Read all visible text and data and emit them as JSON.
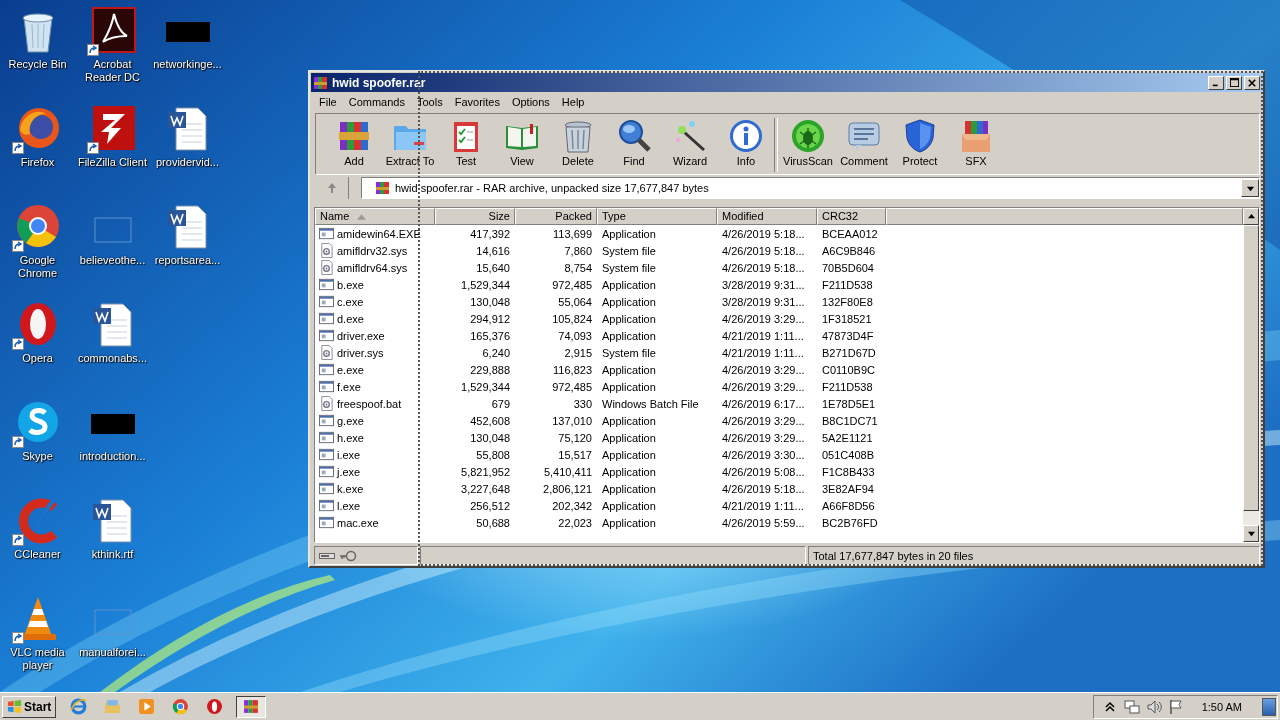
{
  "desktop_icons": [
    {
      "label": "Recycle Bin",
      "kind": "recycle",
      "shortcut": false
    },
    {
      "label": "Firefox",
      "kind": "firefox",
      "shortcut": true
    },
    {
      "label": "Google Chrome",
      "kind": "chrome",
      "shortcut": true
    },
    {
      "label": "Opera",
      "kind": "opera",
      "shortcut": true
    },
    {
      "label": "Skype",
      "kind": "skype",
      "shortcut": true
    },
    {
      "label": "CCleaner",
      "kind": "ccleaner",
      "shortcut": true
    },
    {
      "label": "VLC media player",
      "kind": "vlc",
      "shortcut": true
    },
    {
      "label": "Acrobat Reader DC",
      "kind": "acrobat",
      "shortcut": true
    },
    {
      "label": "FileZilla Client",
      "kind": "filezilla",
      "shortcut": true
    },
    {
      "label": "believeothe...",
      "kind": "blank",
      "shortcut": false
    },
    {
      "label": "commonabs...",
      "kind": "word",
      "shortcut": false
    },
    {
      "label": "introduction...",
      "kind": "redacted",
      "shortcut": false
    },
    {
      "label": "kthink.rtf",
      "kind": "word",
      "shortcut": false
    },
    {
      "label": "manualforei...",
      "kind": "blank",
      "shortcut": false
    },
    {
      "label": "networkinge...",
      "kind": "redacted",
      "shortcut": false
    },
    {
      "label": "providervid...",
      "kind": "word",
      "shortcut": false
    },
    {
      "label": "reportsarea...",
      "kind": "word",
      "shortcut": false
    }
  ],
  "window": {
    "title": "hwid spoofer.rar",
    "menu": [
      "File",
      "Commands",
      "Tools",
      "Favorites",
      "Options",
      "Help"
    ],
    "toolbar": [
      {
        "label": "Add",
        "kind": "add"
      },
      {
        "label": "Extract To",
        "kind": "extract"
      },
      {
        "label": "Test",
        "kind": "test"
      },
      {
        "label": "View",
        "kind": "view"
      },
      {
        "label": "Delete",
        "kind": "delete"
      },
      {
        "label": "Find",
        "kind": "find"
      },
      {
        "label": "Wizard",
        "kind": "wizard"
      },
      {
        "label": "Info",
        "kind": "info"
      },
      {
        "label": "VirusScan",
        "kind": "virusscan"
      },
      {
        "label": "Comment",
        "kind": "comment"
      },
      {
        "label": "Protect",
        "kind": "protect"
      },
      {
        "label": "SFX",
        "kind": "sfx"
      }
    ],
    "address": "hwid spoofer.rar - RAR archive, unpacked size 17,677,847 bytes",
    "columns": [
      {
        "label": "Name",
        "sorted": true
      },
      {
        "label": "Size",
        "sorted": false
      },
      {
        "label": "Packed",
        "sorted": false
      },
      {
        "label": "Type",
        "sorted": false
      },
      {
        "label": "Modified",
        "sorted": false
      },
      {
        "label": "CRC32",
        "sorted": false
      }
    ],
    "rows": [
      {
        "kind": "exe",
        "name": "amidewin64.EXE",
        "size": "417,392",
        "packed": "113,699",
        "type": "Application",
        "modified": "4/26/2019 5:18...",
        "crc": "BCEAA012"
      },
      {
        "kind": "sys",
        "name": "amifldrv32.sys",
        "size": "14,616",
        "packed": "7,860",
        "type": "System file",
        "modified": "4/26/2019 5:18...",
        "crc": "A6C9B846"
      },
      {
        "kind": "sys",
        "name": "amifldrv64.sys",
        "size": "15,640",
        "packed": "8,754",
        "type": "System file",
        "modified": "4/26/2019 5:18...",
        "crc": "70B5D604"
      },
      {
        "kind": "exe",
        "name": "b.exe",
        "size": "1,529,344",
        "packed": "972,485",
        "type": "Application",
        "modified": "3/28/2019 9:31...",
        "crc": "F211D538"
      },
      {
        "kind": "exe",
        "name": "c.exe",
        "size": "130,048",
        "packed": "55,064",
        "type": "Application",
        "modified": "3/28/2019 9:31...",
        "crc": "132F80E8"
      },
      {
        "kind": "exe",
        "name": "d.exe",
        "size": "294,912",
        "packed": "105,824",
        "type": "Application",
        "modified": "4/26/2019 3:29...",
        "crc": "1F318521"
      },
      {
        "kind": "exe",
        "name": "driver.exe",
        "size": "165,376",
        "packed": "74,093",
        "type": "Application",
        "modified": "4/21/2019 1:11...",
        "crc": "47873D4F"
      },
      {
        "kind": "sys",
        "name": "driver.sys",
        "size": "6,240",
        "packed": "2,915",
        "type": "System file",
        "modified": "4/21/2019 1:11...",
        "crc": "B271D67D"
      },
      {
        "kind": "exe",
        "name": "e.exe",
        "size": "229,888",
        "packed": "116,823",
        "type": "Application",
        "modified": "4/26/2019 3:29...",
        "crc": "C0110B9C"
      },
      {
        "kind": "exe",
        "name": "f.exe",
        "size": "1,529,344",
        "packed": "972,485",
        "type": "Application",
        "modified": "4/26/2019 3:29...",
        "crc": "F211D538"
      },
      {
        "kind": "bat",
        "name": "freespoof.bat",
        "size": "679",
        "packed": "330",
        "type": "Windows Batch File",
        "modified": "4/26/2019 6:17...",
        "crc": "1E78D5E1"
      },
      {
        "kind": "exe",
        "name": "g.exe",
        "size": "452,608",
        "packed": "137,010",
        "type": "Application",
        "modified": "4/26/2019 3:29...",
        "crc": "B8C1DC71"
      },
      {
        "kind": "exe",
        "name": "h.exe",
        "size": "130,048",
        "packed": "75,120",
        "type": "Application",
        "modified": "4/26/2019 3:29...",
        "crc": "5A2E1121"
      },
      {
        "kind": "exe",
        "name": "i.exe",
        "size": "55,808",
        "packed": "15,517",
        "type": "Application",
        "modified": "4/26/2019 3:30...",
        "crc": "051C408B"
      },
      {
        "kind": "exe",
        "name": "j.exe",
        "size": "5,821,952",
        "packed": "5,410,411",
        "type": "Application",
        "modified": "4/26/2019 5:08...",
        "crc": "F1C8B433"
      },
      {
        "kind": "exe",
        "name": "k.exe",
        "size": "3,227,648",
        "packed": "2,806,121",
        "type": "Application",
        "modified": "4/26/2019 5:18...",
        "crc": "3E82AF94"
      },
      {
        "kind": "exe",
        "name": "l.exe",
        "size": "256,512",
        "packed": "202,342",
        "type": "Application",
        "modified": "4/21/2019 1:11...",
        "crc": "A66F8D56"
      },
      {
        "kind": "exe",
        "name": "mac.exe",
        "size": "50,688",
        "packed": "22,023",
        "type": "Application",
        "modified": "4/26/2019 5:59...",
        "crc": "BC2B76FD"
      }
    ],
    "status": "Total 17,677,847 bytes in 20 files"
  },
  "taskbar": {
    "start": "Start",
    "apps": [
      {
        "kind": "ie",
        "active": false
      },
      {
        "kind": "explorer",
        "active": false
      },
      {
        "kind": "media",
        "active": false
      },
      {
        "kind": "chrome",
        "active": false
      },
      {
        "kind": "opera",
        "active": false
      },
      {
        "kind": "winrar",
        "active": true
      }
    ],
    "tray": [
      {
        "kind": "chevron"
      },
      {
        "kind": "network"
      },
      {
        "kind": "volume"
      },
      {
        "kind": "flag"
      }
    ],
    "clock": "1:50 AM"
  }
}
